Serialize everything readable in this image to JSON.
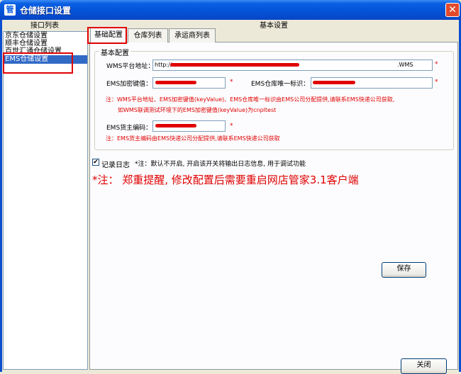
{
  "window": {
    "title": "仓储接口设置",
    "app_icon": "app-icon"
  },
  "left": {
    "header": "接口列表",
    "items": [
      "京东仓储设置",
      "顺丰仓储设置",
      "百世汇通仓储设置",
      "EMS仓储设置"
    ],
    "selected_index": 3
  },
  "right": {
    "header": "基本设置",
    "tabs": [
      "基础配置",
      "仓库列表",
      "承运商列表"
    ],
    "active_tab": 0
  },
  "group": {
    "title": "基本配置",
    "wms_label": "WMS平台地址：",
    "wms_value": "http://",
    "wms_value_tail": ".WMS",
    "key_label": "EMS加密键值：",
    "ems_id_label": "EMS仓库唯一标识：",
    "note1_line1": "注：WMS平台地址、EMS加密键值(keyValue)、EMS仓库唯一标识由EMS公司分配提供,请联系EMS快递公司获取,",
    "note1_line2": "如WMS联调测试环境下的EMS加密键值(keyValue)为cnpltest",
    "owner_label": "EMS货主编码：",
    "note2": "注：EMS货主编码由EMS快递公司分配提供,请联系EMS快递公司获取",
    "required_mark": "*"
  },
  "log": {
    "checked": true,
    "check_glyph": "✔",
    "label": "记录日志",
    "hint": "*注：默认不开启, 开启该开关将输出日志信息, 用于调试功能"
  },
  "warning": "*注： 郑重提醒, 修改配置后需要重启网店管家3.1客户端",
  "buttons": {
    "save": "保存",
    "close": "关闭",
    "window_close": "✕"
  },
  "colors": {
    "accent_red": "#E00000",
    "title_blue": "#0A5FE2",
    "selection": "#316AC5"
  }
}
